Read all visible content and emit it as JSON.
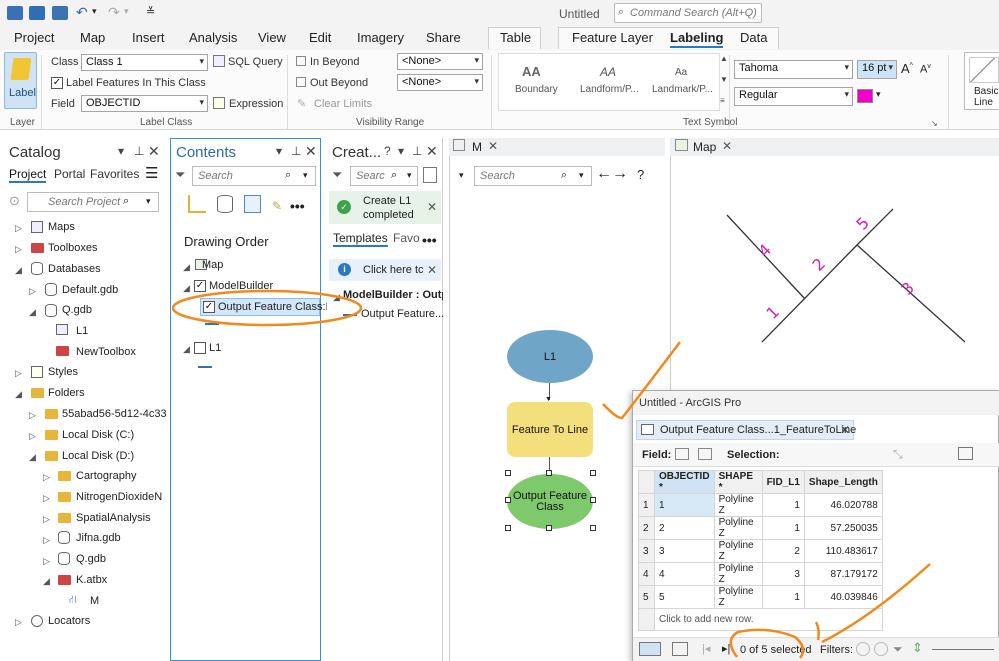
{
  "app": {
    "title": "Untitled",
    "command_search_placeholder": "Command Search (Alt+Q)"
  },
  "menu_tabs": [
    "Project",
    "Map",
    "Insert",
    "Analysis",
    "View",
    "Edit",
    "Imagery",
    "Share"
  ],
  "context_tabs": {
    "table": "Table",
    "feature_layer": "Feature Layer",
    "labeling": "Labeling",
    "data": "Data"
  },
  "ribbon": {
    "layer_button": "Label",
    "class_label": "Class",
    "class_value": "Class 1",
    "sql_query": "SQL Query",
    "label_features_in_class": "Label Features In This Class",
    "field_label": "Field",
    "field_value": "OBJECTID",
    "expression": "Expression",
    "group_layer": "Layer",
    "group_label_class": "Label Class",
    "in_beyond": "In Beyond",
    "out_beyond": "Out Beyond",
    "clear_limits": "Clear Limits",
    "in_beyond_value": "<None>",
    "out_beyond_value": "<None>",
    "group_visibility": "Visibility Range",
    "styles": [
      {
        "preview": "AA",
        "name": "Boundary"
      },
      {
        "preview": "AA",
        "name": "Landform/P..."
      },
      {
        "preview": "Aa",
        "name": "Landmark/P..."
      }
    ],
    "font_name": "Tahoma",
    "font_size": "16 pt",
    "font_style": "Regular",
    "font_color": "#ee00c8",
    "group_text_symbol": "Text Symbol",
    "basic_line": "Basic Line"
  },
  "catalog": {
    "title": "Catalog",
    "tabs": [
      "Project",
      "Portal",
      "Favorites"
    ],
    "search_placeholder": "Search Project",
    "items": [
      {
        "label": "Maps"
      },
      {
        "label": "Toolboxes"
      },
      {
        "label": "Databases"
      },
      {
        "label": "Default.gdb"
      },
      {
        "label": "Q.gdb"
      },
      {
        "label": "L1"
      },
      {
        "label": "NewToolbox"
      },
      {
        "label": "Styles"
      },
      {
        "label": "Folders"
      },
      {
        "label": "55abad56-5d12-4c33"
      },
      {
        "label": "Local Disk (C:)"
      },
      {
        "label": "Local Disk (D:)"
      },
      {
        "label": "Cartography"
      },
      {
        "label": "NitrogenDioxideN"
      },
      {
        "label": "SpatialAnalysis"
      },
      {
        "label": "Jifna.gdb"
      },
      {
        "label": "Q.gdb"
      },
      {
        "label": "K.atbx"
      },
      {
        "label": "M"
      },
      {
        "label": "Locators"
      }
    ]
  },
  "contents": {
    "title": "Contents",
    "search_placeholder": "Search",
    "drawing_order": "Drawing Order",
    "map": "Map",
    "modelbuilder": "ModelBuilder",
    "output_fc": "Output Feature Class:L",
    "l1": "L1"
  },
  "create": {
    "title": "Creat...",
    "search_placeholder": "Searc",
    "notice_line1": "Create L1",
    "notice_line2": "completed",
    "tabs": [
      "Templates",
      "Favo"
    ],
    "info": "Click here tc",
    "mb_group": "ModelBuilder : Outp",
    "mb_item": "Output Feature..."
  },
  "model": {
    "tab": "M",
    "search_placeholder": "Search",
    "nodes": {
      "l1": "L1",
      "tool": "Feature To Line",
      "output": "Output Feature Class"
    }
  },
  "map": {
    "tab": "Map",
    "labels": [
      "1",
      "2",
      "3",
      "4",
      "5"
    ]
  },
  "table_window": {
    "window_title": "Untitled - ArcGIS Pro",
    "tab": "Output Feature Class...1_FeatureToLine",
    "field_label": "Field:",
    "selection_label": "Selection:",
    "columns": [
      "OBJECTID *",
      "SHAPE *",
      "FID_L1",
      "Shape_Length"
    ],
    "rows": [
      [
        "1",
        "Polyline Z",
        "1",
        "46.020788"
      ],
      [
        "2",
        "Polyline Z",
        "1",
        "57.250035"
      ],
      [
        "3",
        "Polyline Z",
        "2",
        "110.483617"
      ],
      [
        "4",
        "Polyline Z",
        "3",
        "87.179172"
      ],
      [
        "5",
        "Polyline Z",
        "1",
        "40.039846"
      ]
    ],
    "add_row": "Click to add new row.",
    "selected": "0 of 5 selected",
    "filters": "Filters:"
  }
}
